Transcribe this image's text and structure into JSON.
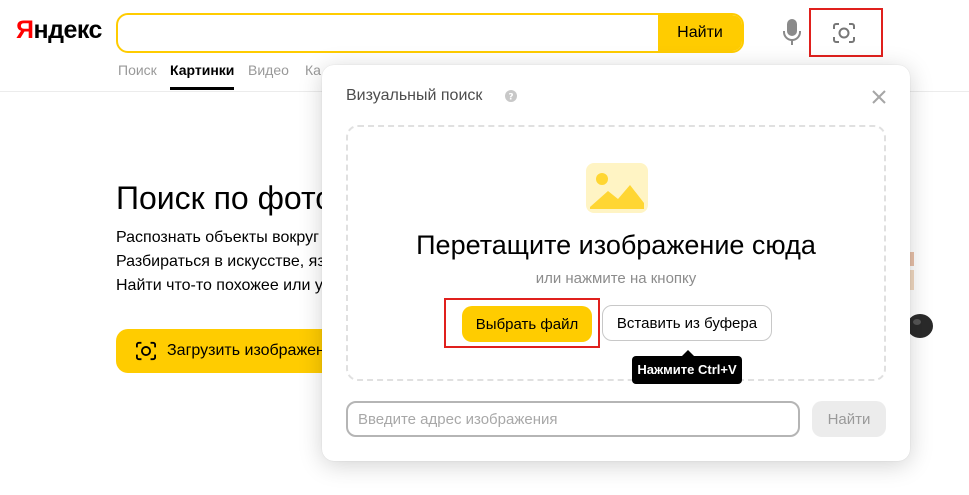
{
  "header": {
    "logo_first": "Я",
    "logo_rest": "ндекс",
    "search_value": "",
    "search_button": "Найти",
    "mic_icon": "microphone-icon",
    "lens_icon": "camera-lens-icon"
  },
  "tabs": [
    {
      "label": "Поиск",
      "active": false
    },
    {
      "label": "Картинки",
      "active": true
    },
    {
      "label": "Видео",
      "active": false
    },
    {
      "label": "Ка",
      "active": false
    }
  ],
  "hero": {
    "title": "Поиск по фото",
    "lines": [
      "Распознать объекты вокруг",
      "Разбираться в искусстве, яз",
      "Найти что-то похожее или у"
    ],
    "upload_label": "Загрузить изображение"
  },
  "modal": {
    "title": "Визуальный поиск",
    "drop_title": "Перетащите изображение сюда",
    "drop_subtitle": "или нажмите на кнопку",
    "choose_file": "Выбрать файл",
    "paste_buffer": "Вставить из буфера",
    "tooltip": "Нажмите Ctrl+V",
    "url_placeholder": "Введите адрес изображения",
    "url_value": "",
    "url_submit": "Найти"
  },
  "colors": {
    "accent": "#ffcc00",
    "highlight": "#e0201d",
    "logo_red": "#ff0000"
  }
}
